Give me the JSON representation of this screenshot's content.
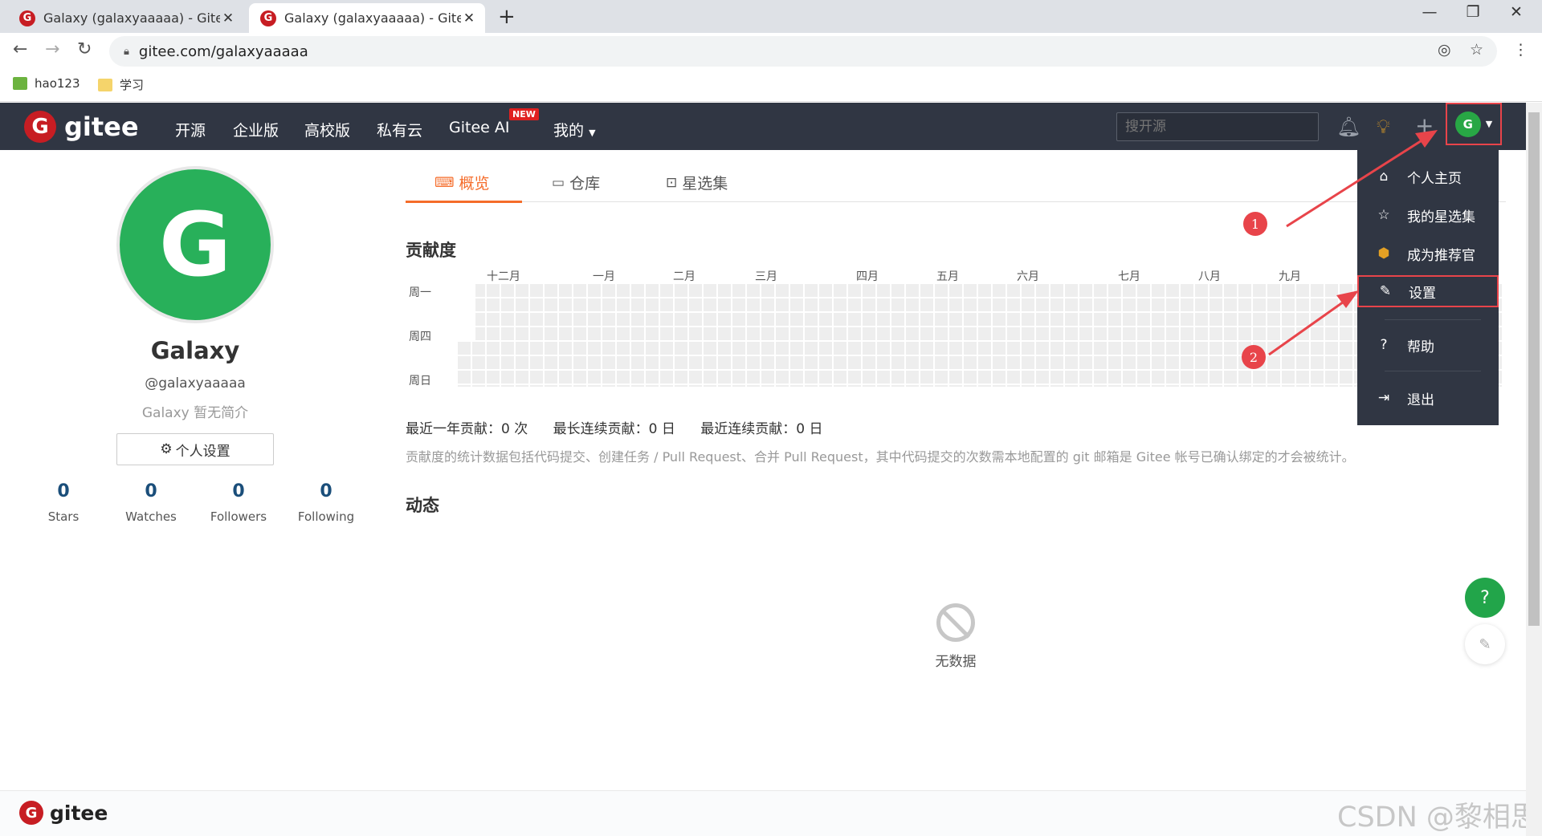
{
  "browser": {
    "tabs": [
      {
        "title": "Galaxy (galaxyaaaaa) - Gitee.cc",
        "favicon": "gitee-icon",
        "active": false
      },
      {
        "title": "Galaxy (galaxyaaaaa) - Gitee.cc",
        "favicon": "gitee-icon",
        "active": true
      }
    ],
    "url": "gitee.com/galaxyaaaaa",
    "bookmarks": [
      {
        "label": "hao123",
        "icon": "hao123-icon"
      },
      {
        "label": "学习",
        "icon": "folder-icon"
      }
    ]
  },
  "header": {
    "logo_text": "gitee",
    "nav": [
      "开源",
      "企业版",
      "高校版",
      "私有云",
      "Gitee AI",
      "我的"
    ],
    "new_badge": "NEW",
    "search_placeholder": "搜开源",
    "avatar_letter": "G"
  },
  "profile": {
    "avatar_letter": "G",
    "name": "Galaxy",
    "username": "@galaxyaaaaa",
    "bio": "Galaxy 暂无简介",
    "settings_label": "个人设置",
    "stats": [
      {
        "value": "0",
        "label": "Stars"
      },
      {
        "value": "0",
        "label": "Watches"
      },
      {
        "value": "0",
        "label": "Followers"
      },
      {
        "value": "0",
        "label": "Following"
      }
    ]
  },
  "main": {
    "tabs": [
      {
        "label": "概览",
        "icon": "code-icon"
      },
      {
        "label": "仓库",
        "icon": "repo-icon"
      },
      {
        "label": "星选集",
        "icon": "star-box-icon"
      }
    ],
    "contrib_title": "贡献度",
    "months": [
      "十二月",
      "一月",
      "二月",
      "三月",
      "四月",
      "五月",
      "六月",
      "七月",
      "八月",
      "九月"
    ],
    "weekdays": [
      "周一",
      "周四",
      "周日"
    ],
    "stats": [
      "最近一年贡献：0 次",
      "最长连续贡献：0 日",
      "最近连续贡献：0 日"
    ],
    "note": "贡献度的统计数据包括代码提交、创建任务 / Pull Request、合并 Pull Request，其中代码提交的次数需本地配置的 git 邮箱是 Gitee 帐号已确认绑定的才会被统计。",
    "activity_title": "动态",
    "nodata": "无数据"
  },
  "dropdown": {
    "items": [
      {
        "label": "个人主页",
        "icon": "home-icon"
      },
      {
        "label": "我的星选集",
        "icon": "star-icon"
      },
      {
        "label": "成为推荐官",
        "icon": "badge-icon"
      },
      {
        "label": "设置",
        "icon": "edit-icon"
      },
      {
        "label": "帮助",
        "icon": "help-icon"
      },
      {
        "label": "退出",
        "icon": "logout-icon"
      }
    ]
  },
  "annotations": {
    "markers": [
      "1",
      "2"
    ],
    "color": "#e8444a"
  },
  "footer": {
    "logo_text": "gitee",
    "watermark": "CSDN @黎相思"
  },
  "colors": {
    "header_bg": "#303643",
    "accent": "#f56c2a",
    "avatar_green": "#28b05a",
    "gitee_red": "#c71d23"
  }
}
